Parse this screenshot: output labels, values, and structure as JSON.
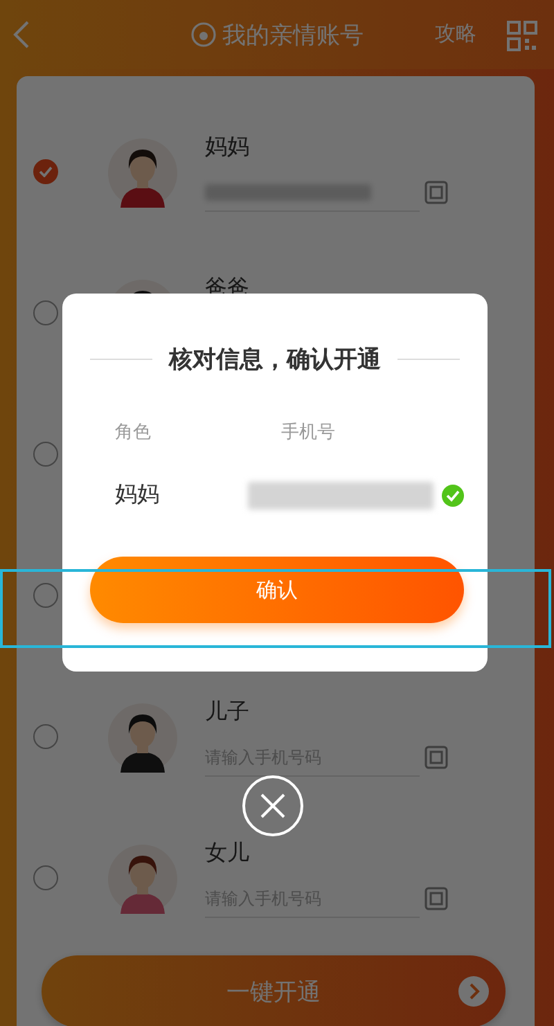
{
  "header": {
    "title": "我的亲情账号",
    "guide_link": "攻略"
  },
  "members": [
    {
      "name": "妈妈",
      "checked": true,
      "phone_blurred": true
    },
    {
      "name": "爸爸",
      "checked": false
    },
    {
      "checked": false
    },
    {
      "checked": false
    },
    {
      "name": "儿子",
      "checked": false,
      "placeholder": "请输入手机号码"
    },
    {
      "name": "女儿",
      "checked": false,
      "placeholder": "请输入手机号码"
    }
  ],
  "open_button": "一键开通",
  "dialog": {
    "title": "核对信息，确认开通",
    "columns": [
      "角色",
      "手机号"
    ],
    "rows": [
      {
        "role": "妈妈",
        "phone_blurred": true,
        "verified": true
      }
    ],
    "confirm_button": "确认"
  }
}
